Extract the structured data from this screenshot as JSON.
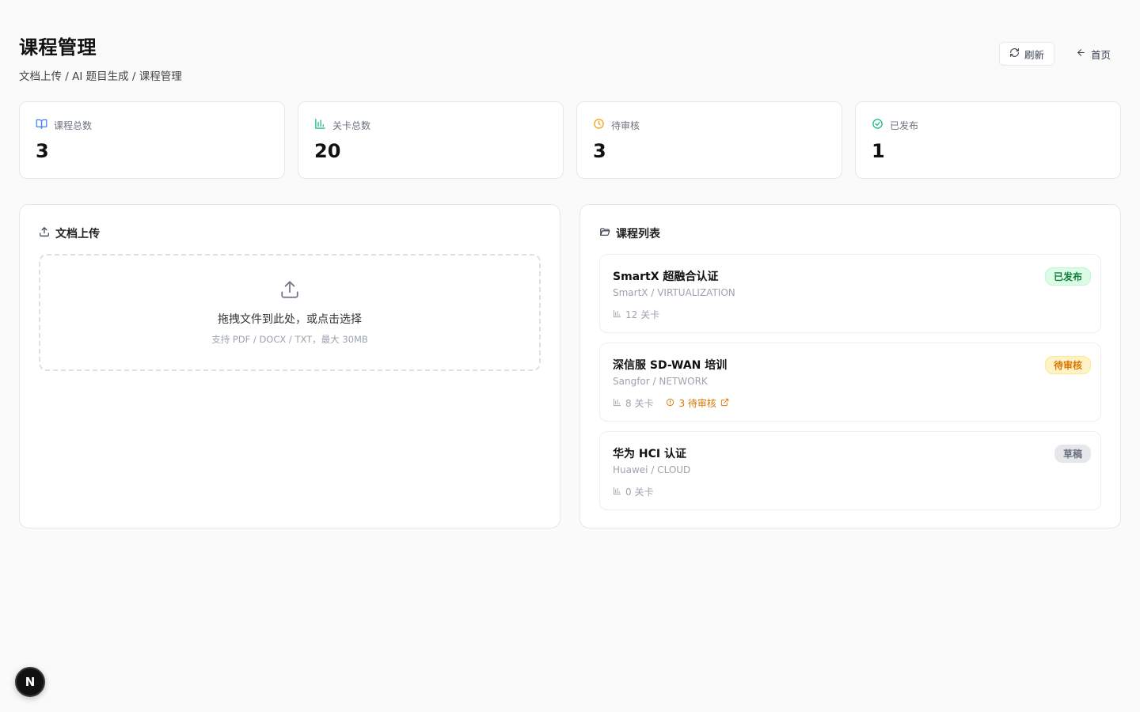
{
  "header": {
    "title": "课程管理",
    "breadcrumb": "文档上传 / AI 题目生成 / 课程管理",
    "refresh_label": "刷新",
    "home_label": "首页"
  },
  "stats": [
    {
      "label": "课程总数",
      "value": "3",
      "icon": "book-open-icon",
      "color": "#3b82f6"
    },
    {
      "label": "关卡总数",
      "value": "20",
      "icon": "bar-chart-icon",
      "color": "#10b981"
    },
    {
      "label": "待审核",
      "value": "3",
      "icon": "clock-icon",
      "color": "#f59e0b"
    },
    {
      "label": "已发布",
      "value": "1",
      "icon": "check-circle-icon",
      "color": "#10b981"
    }
  ],
  "upload": {
    "title": "文档上传",
    "drop_text": "拖拽文件到此处，或点击选择",
    "hint": "支持 PDF / DOCX / TXT，最大 30MB"
  },
  "courses": {
    "title": "课程列表",
    "items": [
      {
        "name": "SmartX 超融合认证",
        "org": "SmartX / VIRTUALIZATION",
        "levels": "12 关卡",
        "pending": "",
        "status": "已发布",
        "status_kind": "published"
      },
      {
        "name": "深信服 SD-WAN 培训",
        "org": "Sangfor / NETWORK",
        "levels": "8 关卡",
        "pending": "3 待审核",
        "status": "待审核",
        "status_kind": "pending"
      },
      {
        "name": "华为 HCI 认证",
        "org": "Huawei / CLOUD",
        "levels": "0 关卡",
        "pending": "",
        "status": "草稿",
        "status_kind": "draft"
      }
    ]
  },
  "dev_badge": {
    "letter": "N"
  }
}
